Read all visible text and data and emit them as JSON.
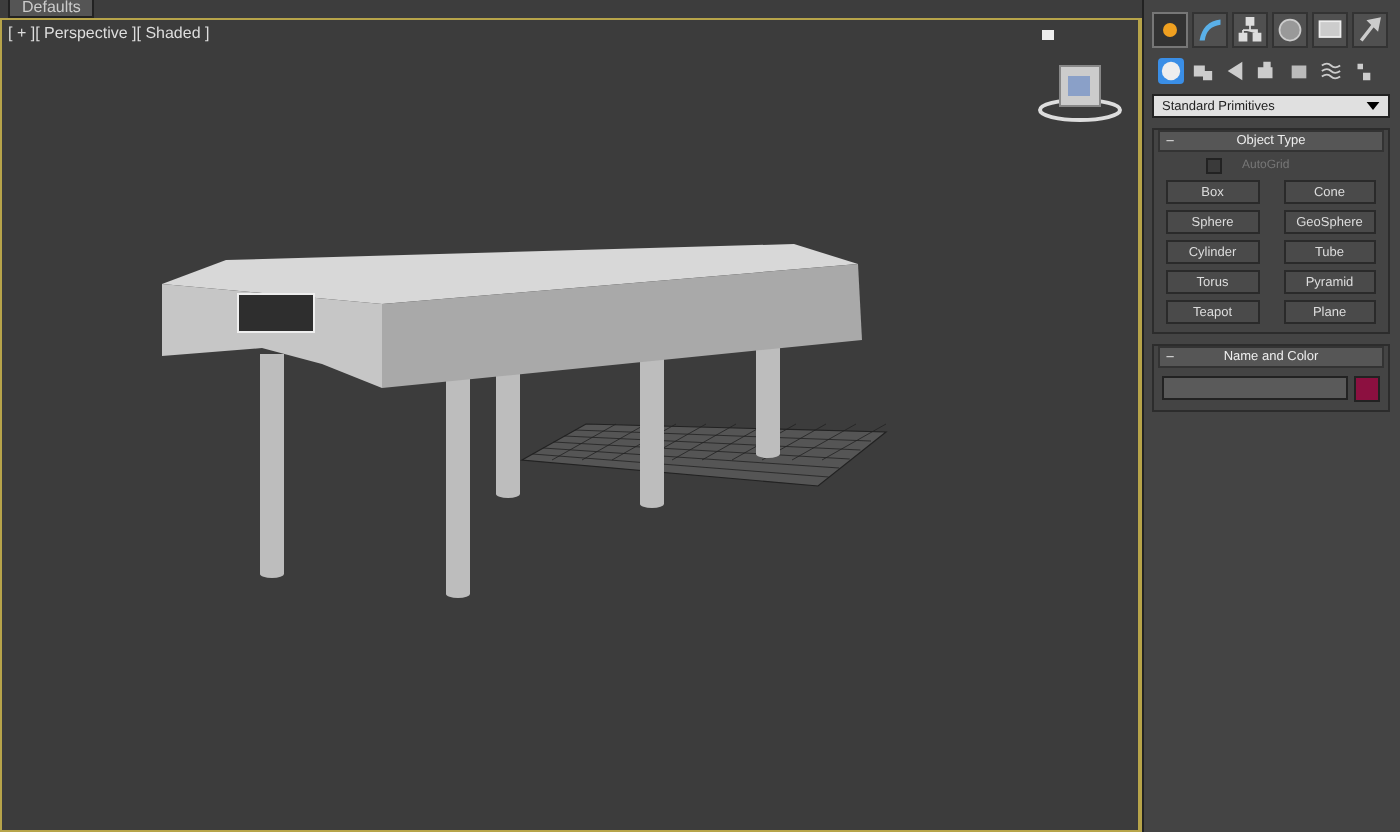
{
  "doc_tab": {
    "label": "Defaults"
  },
  "viewport": {
    "label": "[ + ][ Perspective ][ Shaded ]"
  },
  "command_tabs": [
    {
      "kind": "create",
      "selected": true
    },
    {
      "kind": "modify",
      "selected": false
    },
    {
      "kind": "hierarchy",
      "selected": false
    },
    {
      "kind": "motion",
      "selected": false
    },
    {
      "kind": "display",
      "selected": false
    },
    {
      "kind": "utilities",
      "selected": false
    }
  ],
  "categories": [
    {
      "kind": "geometry",
      "selected": true
    },
    {
      "kind": "shapes",
      "selected": false
    },
    {
      "kind": "lights",
      "selected": false
    },
    {
      "kind": "cameras",
      "selected": false
    },
    {
      "kind": "helpers",
      "selected": false
    },
    {
      "kind": "spacewarps",
      "selected": false
    },
    {
      "kind": "systems",
      "selected": false
    }
  ],
  "dropdown": {
    "value": "Standard Primitives"
  },
  "object_type": {
    "toggle": "–",
    "title": "Object Type",
    "autogrid": {
      "label": "AutoGrid",
      "checked": false
    },
    "buttons": [
      "Box",
      "Cone",
      "Sphere",
      "GeoSphere",
      "Cylinder",
      "Tube",
      "Torus",
      "Pyramid",
      "Teapot",
      "Plane"
    ]
  },
  "name_and_color": {
    "toggle": "–",
    "title": "Name and Color",
    "color": "#8c1040"
  }
}
